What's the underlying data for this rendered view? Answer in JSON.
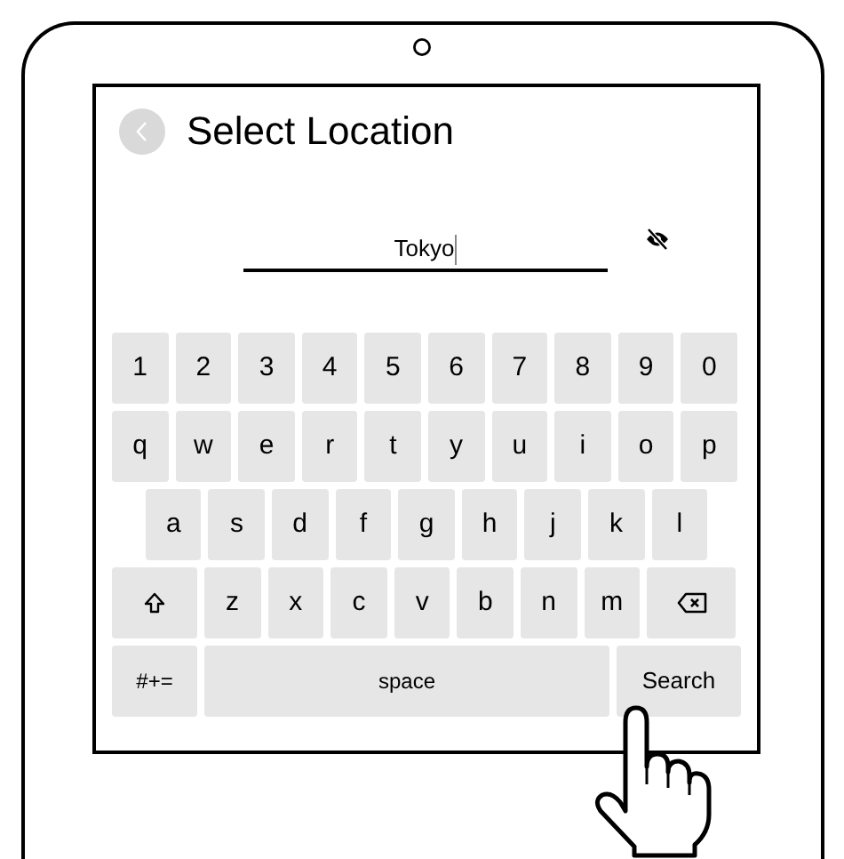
{
  "header": {
    "title": "Select Location"
  },
  "location_field": {
    "value": "Tokyo",
    "focused": true
  },
  "keyboard": {
    "rows": [
      {
        "keys": [
          {
            "kind": "char",
            "label": "1"
          },
          {
            "kind": "char",
            "label": "2"
          },
          {
            "kind": "char",
            "label": "3"
          },
          {
            "kind": "char",
            "label": "4"
          },
          {
            "kind": "char",
            "label": "5"
          },
          {
            "kind": "char",
            "label": "6"
          },
          {
            "kind": "char",
            "label": "7"
          },
          {
            "kind": "char",
            "label": "8"
          },
          {
            "kind": "char",
            "label": "9"
          },
          {
            "kind": "char",
            "label": "0"
          }
        ]
      },
      {
        "keys": [
          {
            "kind": "char",
            "label": "q"
          },
          {
            "kind": "char",
            "label": "w"
          },
          {
            "kind": "char",
            "label": "e"
          },
          {
            "kind": "char",
            "label": "r"
          },
          {
            "kind": "char",
            "label": "t"
          },
          {
            "kind": "char",
            "label": "y"
          },
          {
            "kind": "char",
            "label": "u"
          },
          {
            "kind": "char",
            "label": "i"
          },
          {
            "kind": "char",
            "label": "o"
          },
          {
            "kind": "char",
            "label": "p"
          }
        ]
      },
      {
        "keys": [
          {
            "kind": "char",
            "label": "a"
          },
          {
            "kind": "char",
            "label": "s"
          },
          {
            "kind": "char",
            "label": "d"
          },
          {
            "kind": "char",
            "label": "f"
          },
          {
            "kind": "char",
            "label": "g"
          },
          {
            "kind": "char",
            "label": "h"
          },
          {
            "kind": "char",
            "label": "j"
          },
          {
            "kind": "char",
            "label": "k"
          },
          {
            "kind": "char",
            "label": "l"
          }
        ]
      },
      {
        "keys": [
          {
            "kind": "shift"
          },
          {
            "kind": "char",
            "label": "z"
          },
          {
            "kind": "char",
            "label": "x"
          },
          {
            "kind": "char",
            "label": "c"
          },
          {
            "kind": "char",
            "label": "v"
          },
          {
            "kind": "char",
            "label": "b"
          },
          {
            "kind": "char",
            "label": "n"
          },
          {
            "kind": "char",
            "label": "m"
          },
          {
            "kind": "backspace"
          }
        ]
      },
      {
        "keys": [
          {
            "kind": "symbols",
            "label": "#+="
          },
          {
            "kind": "space",
            "label": "space"
          },
          {
            "kind": "action",
            "label": "Search"
          }
        ]
      }
    ]
  }
}
